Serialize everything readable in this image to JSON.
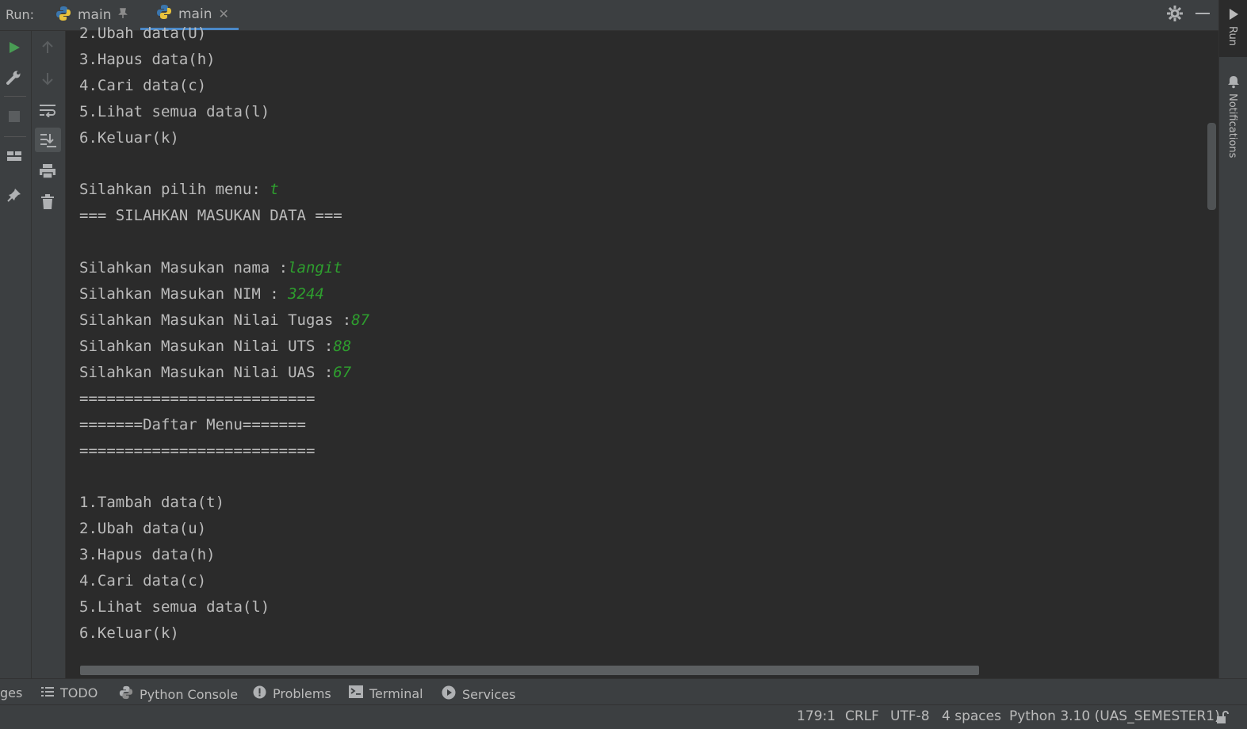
{
  "run_bar": {
    "label": "Run:",
    "tabs": [
      {
        "label": "main",
        "pinned": true
      },
      {
        "label": "main",
        "closable": true,
        "active": true
      }
    ]
  },
  "right_strip": {
    "run_label": "Run",
    "notifications_label": "Notifications"
  },
  "console_lines": [
    {
      "text": "2.Ubah data(U)",
      "input": ""
    },
    {
      "text": "3.Hapus data(h)",
      "input": ""
    },
    {
      "text": "4.Cari data(c)",
      "input": ""
    },
    {
      "text": "5.Lihat semua data(l)",
      "input": ""
    },
    {
      "text": "6.Keluar(k)",
      "input": ""
    },
    {
      "text": "",
      "input": ""
    },
    {
      "text": "Silahkan pilih menu: ",
      "input": "t"
    },
    {
      "text": "=== SILAHKAN MASUKAN DATA ===",
      "input": ""
    },
    {
      "text": "",
      "input": ""
    },
    {
      "text": "Silahkan Masukan nama :",
      "input": "langit"
    },
    {
      "text": "Silahkan Masukan NIM : ",
      "input": "3244"
    },
    {
      "text": "Silahkan Masukan Nilai Tugas :",
      "input": "87"
    },
    {
      "text": "Silahkan Masukan Nilai UTS :",
      "input": "88"
    },
    {
      "text": "Silahkan Masukan Nilai UAS :",
      "input": "67"
    },
    {
      "text": "==========================",
      "input": ""
    },
    {
      "text": "=======Daftar Menu=======",
      "input": ""
    },
    {
      "text": "==========================",
      "input": ""
    },
    {
      "text": "",
      "input": ""
    },
    {
      "text": "1.Tambah data(t)",
      "input": ""
    },
    {
      "text": "2.Ubah data(u)",
      "input": ""
    },
    {
      "text": "3.Hapus data(h)",
      "input": ""
    },
    {
      "text": "4.Cari data(c)",
      "input": ""
    },
    {
      "text": "5.Lihat semua data(l)",
      "input": ""
    },
    {
      "text": "6.Keluar(k)",
      "input": ""
    }
  ],
  "tool_windows": [
    {
      "label": "ges",
      "icon": "changes-icon"
    },
    {
      "label": "TODO",
      "icon": "list-icon"
    },
    {
      "label": "Python Console",
      "icon": "python-icon"
    },
    {
      "label": "Problems",
      "icon": "info-icon"
    },
    {
      "label": "Terminal",
      "icon": "terminal-icon"
    },
    {
      "label": "Services",
      "icon": "play-circle-icon"
    }
  ],
  "status_bar": {
    "position": "179:1",
    "line_separator": "CRLF",
    "encoding": "UTF-8",
    "indent": "4 spaces",
    "interpreter": "Python 3.10 (UAS_SEMESTER1)"
  },
  "colors": {
    "user_input": "#2e9f2e",
    "accent": "#4a88c7",
    "run_green": "#499c54"
  }
}
